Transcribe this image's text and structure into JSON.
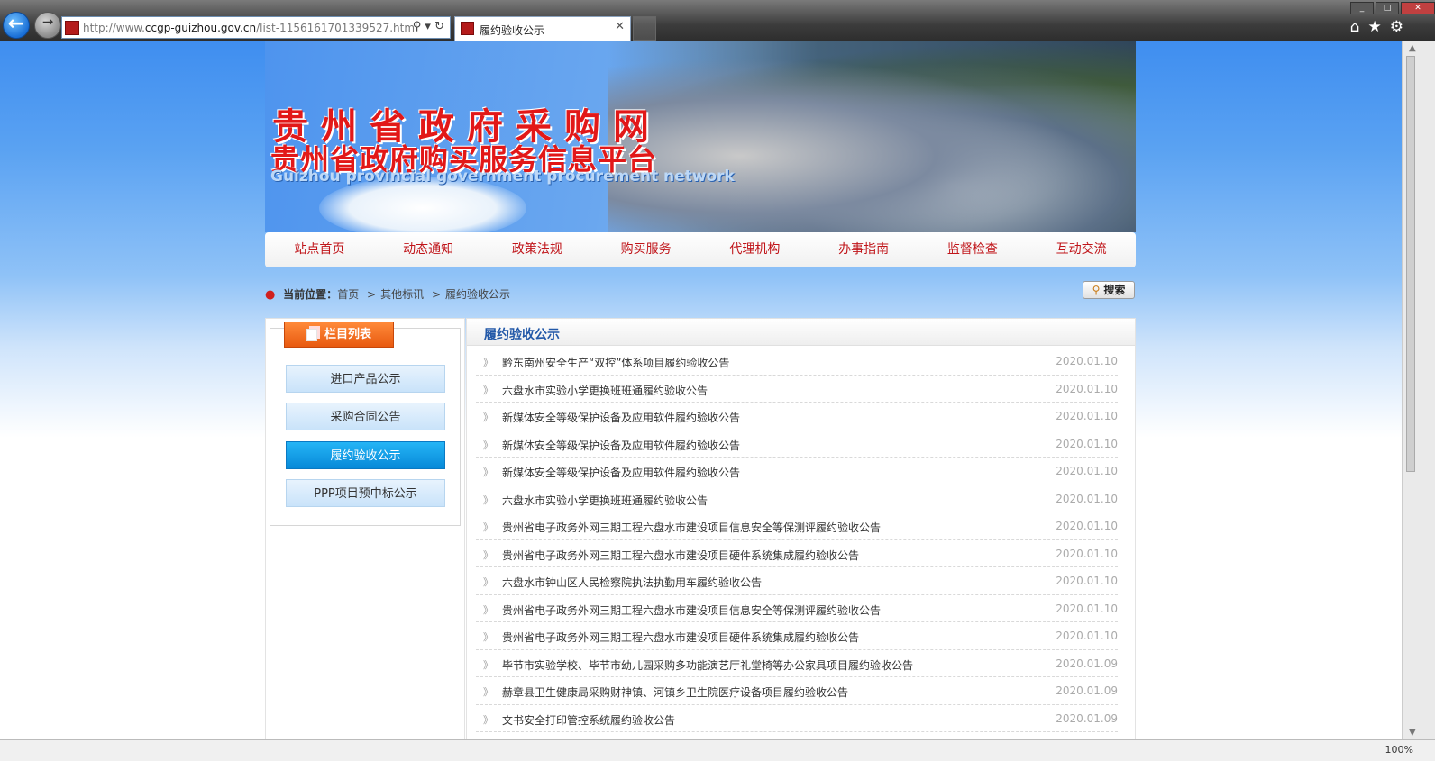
{
  "browser": {
    "url_prefix": "http://www.",
    "url_host": "ccgp-guizhou.gov.cn",
    "url_path": "/list-1156161701339527.html",
    "tab_title": "履约验收公示",
    "zoom": "100%"
  },
  "banner": {
    "title_cn": "贵州省政府采购网",
    "title_cn2": "贵州省政府购买服务信息平台",
    "title_en": "Guizhou provincial government procurement network"
  },
  "nav": {
    "items": [
      {
        "label": "站点首页"
      },
      {
        "label": "动态通知"
      },
      {
        "label": "政策法规"
      },
      {
        "label": "购买服务"
      },
      {
        "label": "代理机构"
      },
      {
        "label": "办事指南"
      },
      {
        "label": "监督检查"
      },
      {
        "label": "互动交流"
      }
    ]
  },
  "breadcrumb": {
    "label": "当前位置：",
    "home": "首页",
    "sep1": ">",
    "level2": "其他标讯",
    "sep2": ">",
    "level3": "履约验收公示"
  },
  "search": {
    "label": "搜索"
  },
  "sidebar": {
    "title": "栏目列表",
    "items": [
      {
        "label": "进口产品公示",
        "active": false
      },
      {
        "label": "采购合同公告",
        "active": false
      },
      {
        "label": "履约验收公示",
        "active": true
      },
      {
        "label": "PPP项目预中标公示",
        "active": false
      }
    ]
  },
  "content": {
    "title": "履约验收公示",
    "rows": [
      {
        "title": "黔东南州安全生产“双控”体系项目履约验收公告",
        "date": "2020.01.10"
      },
      {
        "title": "六盘水市实验小学更换班班通履约验收公告",
        "date": "2020.01.10"
      },
      {
        "title": "新媒体安全等级保护设备及应用软件履约验收公告",
        "date": "2020.01.10"
      },
      {
        "title": "新媒体安全等级保护设备及应用软件履约验收公告",
        "date": "2020.01.10"
      },
      {
        "title": "新媒体安全等级保护设备及应用软件履约验收公告",
        "date": "2020.01.10"
      },
      {
        "title": "六盘水市实验小学更换班班通履约验收公告",
        "date": "2020.01.10"
      },
      {
        "title": "贵州省电子政务外网三期工程六盘水市建设项目信息安全等保测评履约验收公告",
        "date": "2020.01.10"
      },
      {
        "title": "贵州省电子政务外网三期工程六盘水市建设项目硬件系统集成履约验收公告",
        "date": "2020.01.10"
      },
      {
        "title": "六盘水市钟山区人民检察院执法执勤用车履约验收公告",
        "date": "2020.01.10"
      },
      {
        "title": "贵州省电子政务外网三期工程六盘水市建设项目信息安全等保测评履约验收公告",
        "date": "2020.01.10"
      },
      {
        "title": "贵州省电子政务外网三期工程六盘水市建设项目硬件系统集成履约验收公告",
        "date": "2020.01.10"
      },
      {
        "title": "毕节市实验学校、毕节市幼儿园采购多功能演艺厅礼堂椅等办公家具项目履约验收公告",
        "date": "2020.01.09"
      },
      {
        "title": "赫章县卫生健康局采购财神镇、河镇乡卫生院医疗设备项目履约验收公告",
        "date": "2020.01.09"
      },
      {
        "title": "文书安全打印管控系统履约验收公告",
        "date": "2020.01.09"
      }
    ]
  },
  "colors": {
    "brand_red": "#e21818",
    "nav_red": "#c0151a",
    "sidebar_active": "#0789d8",
    "sidebar_head": "#e85a10",
    "content_title": "#2258a8"
  }
}
